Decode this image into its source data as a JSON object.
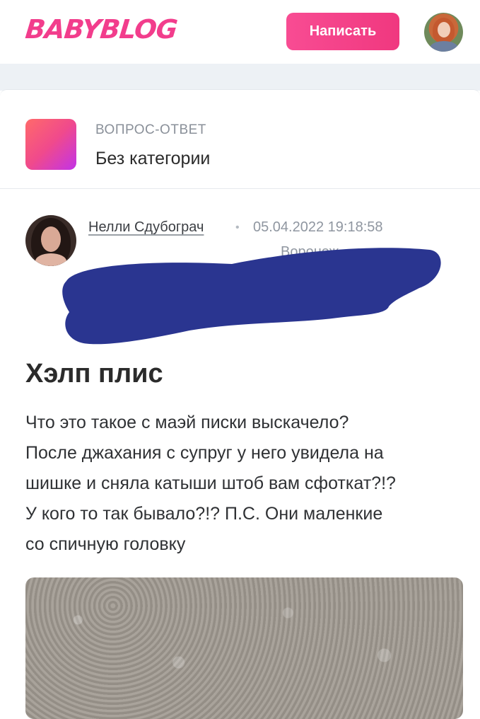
{
  "header": {
    "logo_text": "BABYBLOG",
    "write_button": "Написать"
  },
  "category": {
    "kicker": "ВОПРОС-ОТВЕТ",
    "name": "Без категории"
  },
  "post": {
    "author": "Нелли Сдубограч",
    "separator": "•",
    "date": "05.04.2022 19:18:58",
    "city": "Воронеж",
    "title": "Хэлп плис",
    "body_lines": [
      "Что это такое с маэй писки выскачело?",
      "После джахания с супруг у него увидела на",
      "шишке и сняла катыши штоб вам сфоткат?!?",
      "У кого то так бывало?!? П.С. Они маленкие",
      "со спичную головку"
    ]
  },
  "colors": {
    "brand_pink": "#f23d8c",
    "redaction_blue": "#2a3590",
    "page_band": "#edf1f5"
  }
}
